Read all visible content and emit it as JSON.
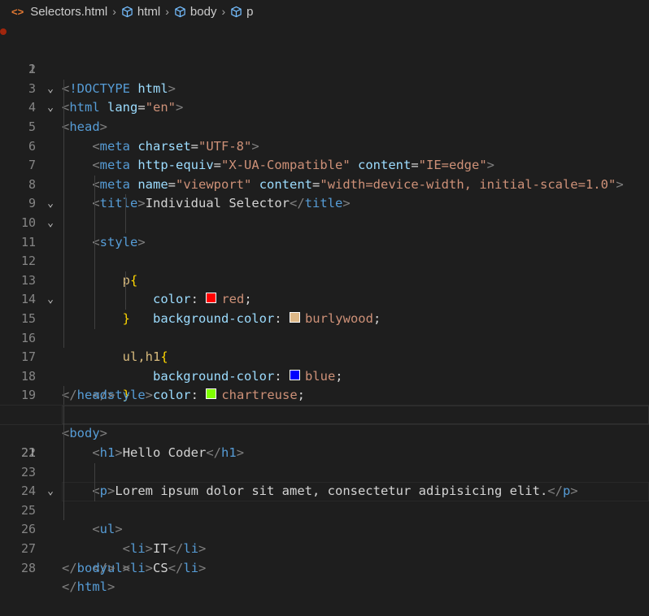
{
  "breadcrumb": {
    "file": "Selectors.html",
    "items": [
      "html",
      "body",
      "p"
    ]
  },
  "colors": {
    "red": "#ff0000",
    "burlywood": "#deb887",
    "blue": "#0000ff",
    "chartreuse": "#7fff00",
    "breakpoint": "#a1260d"
  },
  "lines": [
    {
      "n": "1"
    },
    {
      "n": "2"
    },
    {
      "n": "3"
    },
    {
      "n": "4"
    },
    {
      "n": "5"
    },
    {
      "n": "6"
    },
    {
      "n": "7"
    },
    {
      "n": "8"
    },
    {
      "n": "9"
    },
    {
      "n": "10"
    },
    {
      "n": "11"
    },
    {
      "n": "12"
    },
    {
      "n": "13"
    },
    {
      "n": "14"
    },
    {
      "n": "15"
    },
    {
      "n": "16"
    },
    {
      "n": "17"
    },
    {
      "n": "18"
    },
    {
      "n": "19"
    },
    {
      "n": "20"
    },
    {
      "n": "21"
    },
    {
      "n": "22"
    },
    {
      "n": "23"
    },
    {
      "n": "24"
    },
    {
      "n": "25"
    },
    {
      "n": "26"
    },
    {
      "n": "27"
    },
    {
      "n": "28"
    }
  ],
  "code": {
    "doctype": "!DOCTYPE",
    "doctype_val": "html",
    "html": "html",
    "lang_attr": "lang",
    "lang_val": "\"en\"",
    "head": "head",
    "meta": "meta",
    "charset_attr": "charset",
    "charset_val": "\"UTF-8\"",
    "http_equiv_attr": "http-equiv",
    "http_equiv_val": "\"X-UA-Compatible\"",
    "content_attr": "content",
    "ie_val": "\"IE=edge\"",
    "name_attr": "name",
    "viewport_val": "\"viewport\"",
    "viewport_content_val": "\"width=device-width, initial-scale=1.0\"",
    "title": "title",
    "title_text": "Individual Selector",
    "style": "style",
    "sel_p": "p",
    "sel_ul_h1": "ul,h1",
    "prop_color": "color",
    "prop_bg": "background-color",
    "val_red": "red",
    "val_burlywood": "burlywood",
    "val_blue": "blue",
    "val_chartreuse": "chartreuse",
    "body": "body",
    "h1": "h1",
    "h1_text": "Hello Coder",
    "p": "p",
    "p_text": "Lorem ipsum dolor sit amet, consectetur adipisicing elit.",
    "ul": "ul",
    "li": "li",
    "li1": "IT",
    "li2": "CS"
  }
}
